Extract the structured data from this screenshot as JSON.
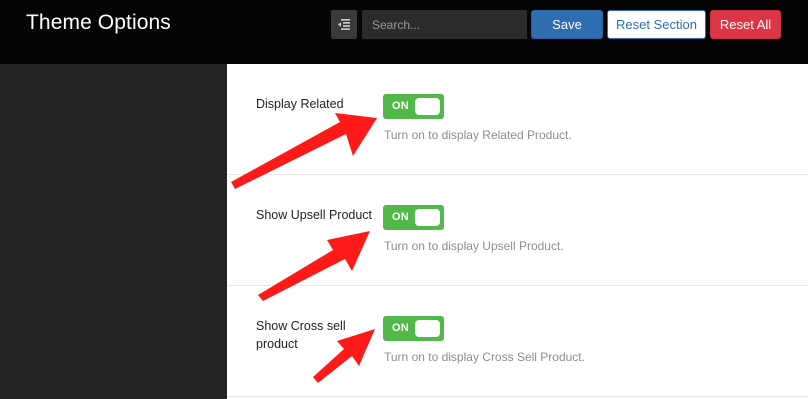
{
  "header": {
    "title": "Theme Options",
    "search_placeholder": "Search...",
    "save_label": "Save",
    "reset_section_label": "Reset Section",
    "reset_all_label": "Reset All"
  },
  "options": [
    {
      "label": "Display Related",
      "toggle": "ON",
      "description": "Turn on to display Related Product."
    },
    {
      "label": "Show Upsell Product",
      "toggle": "ON",
      "description": "Turn on to display Upsell Product."
    },
    {
      "label": "Show Cross sell product",
      "toggle": "ON",
      "description": "Turn on to display Cross Sell Product."
    }
  ],
  "colors": {
    "topbar": "#050505",
    "sidebar": "#242424",
    "primary": "#2e6eb0",
    "danger": "#dc3545",
    "toggle_on": "#52b84a",
    "annotation_arrow": "#ff1a1a"
  }
}
